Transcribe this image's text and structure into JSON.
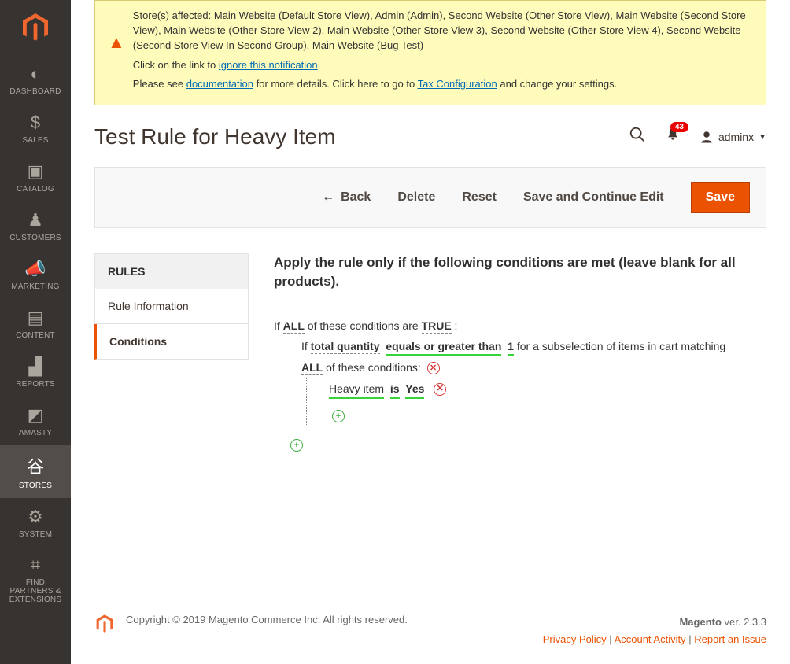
{
  "sidebar": {
    "items": [
      {
        "label": "DASHBOARD"
      },
      {
        "label": "SALES"
      },
      {
        "label": "CATALOG"
      },
      {
        "label": "CUSTOMERS"
      },
      {
        "label": "MARKETING"
      },
      {
        "label": "CONTENT"
      },
      {
        "label": "REPORTS"
      },
      {
        "label": "AMASTY"
      },
      {
        "label": "STORES"
      },
      {
        "label": "SYSTEM"
      },
      {
        "label": "FIND PARTNERS & EXTENSIONS"
      }
    ]
  },
  "notification": {
    "line1": "Store(s) affected: Main Website (Default Store View), Admin (Admin), Second Website (Other Store View), Main Website (Second Store View), Main Website (Other Store View 2), Main Website (Other Store View 3), Second Website (Other Store View 4), Second Website (Second Store View In Second Group), Main Website (Bug Test)",
    "line2_prefix": "Click on the link to ",
    "line2_link": "ignore this notification",
    "line3_prefix": "Please see ",
    "line3_link1": "documentation",
    "line3_mid": " for more details. Click here to go to ",
    "line3_link2": "Tax Configuration",
    "line3_suffix": " and change your settings."
  },
  "page": {
    "title": "Test Rule for Heavy Item"
  },
  "header": {
    "badge": "43",
    "username": "adminx"
  },
  "toolbar": {
    "back": "Back",
    "delete": "Delete",
    "reset": "Reset",
    "save_continue": "Save and Continue Edit",
    "save": "Save"
  },
  "tabs": {
    "heading": "RULES",
    "t1": "Rule Information",
    "t2": "Conditions"
  },
  "conditions": {
    "panel_title": "Apply the rule only if the following conditions are met (leave blank for all products).",
    "l1_if": "If ",
    "l1_all": "ALL",
    "l1_mid": "  of these conditions are ",
    "l1_true": "TRUE",
    "l1_colon": " :",
    "l2_if": "If ",
    "l2_attr": "total quantity",
    "l2_op": "equals or greater than",
    "l2_val": "1",
    "l2_suffix": "  for a subselection of items in cart matching ",
    "l3_all": "ALL",
    "l3_mid": "  of these conditions: ",
    "l4_attr": "Heavy item",
    "l4_is": "is",
    "l4_val": "Yes"
  },
  "footer": {
    "copyright": "Copyright © 2019 Magento Commerce Inc. All rights reserved.",
    "product": "Magento",
    "version": " ver. 2.3.3",
    "privacy": "Privacy Policy",
    "activity": "Account Activity",
    "report": "Report an Issue",
    "sep": " | "
  }
}
